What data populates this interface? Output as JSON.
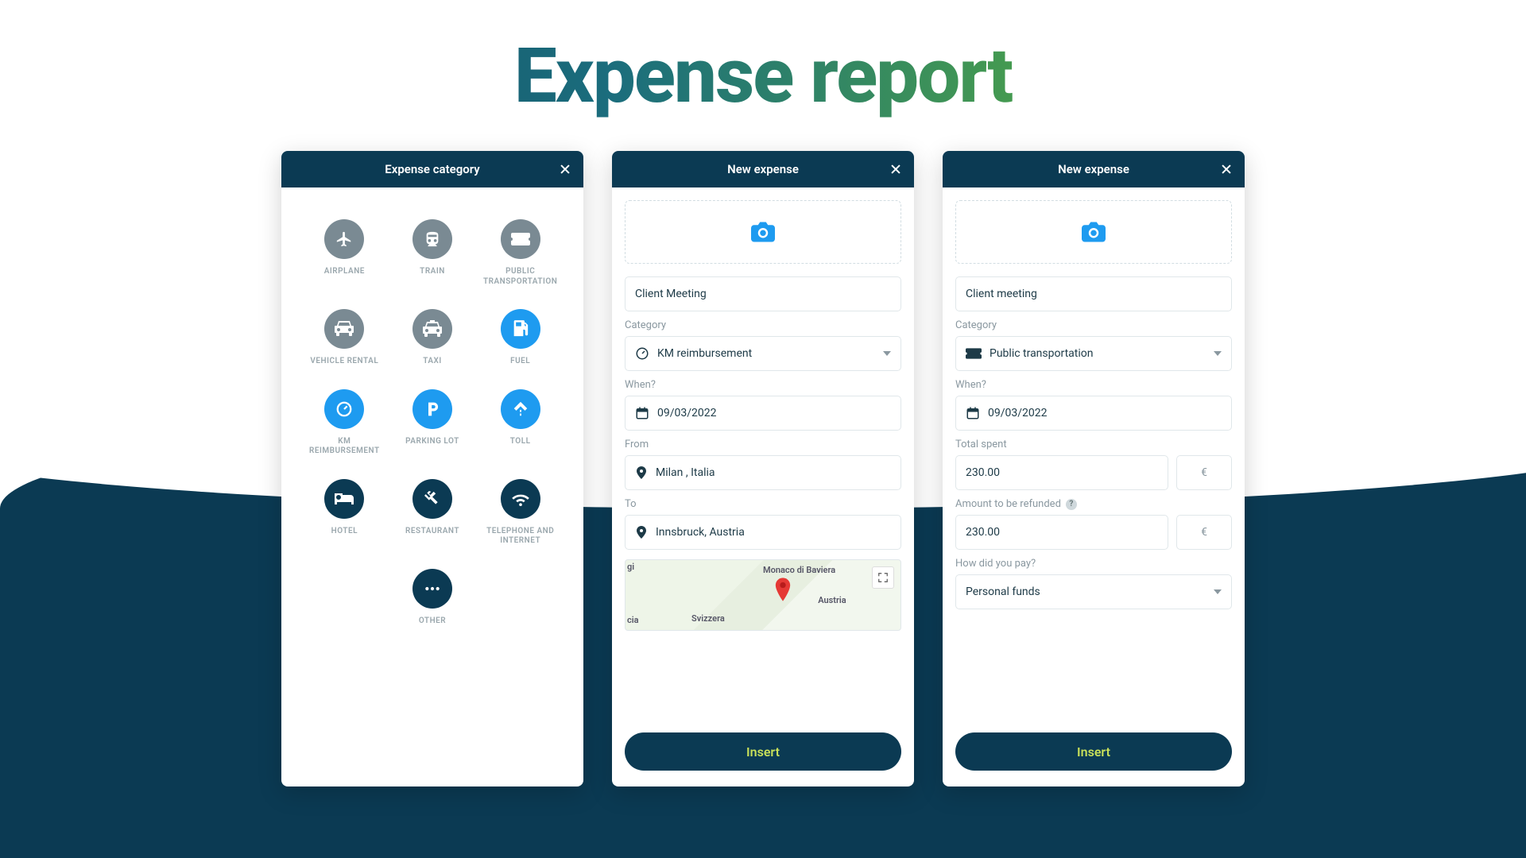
{
  "page_title": "Expense report",
  "panel1": {
    "title": "Expense category",
    "categories": [
      {
        "label": "AIRPLANE",
        "icon": "airplane",
        "cls": "c-grey"
      },
      {
        "label": "TRAIN",
        "icon": "train",
        "cls": "c-grey"
      },
      {
        "label": "PUBLIC TRANSPORTATION",
        "icon": "ticket",
        "cls": "c-grey"
      },
      {
        "label": "VEHICLE RENTAL",
        "icon": "car",
        "cls": "c-grey"
      },
      {
        "label": "TAXI",
        "icon": "taxi",
        "cls": "c-grey"
      },
      {
        "label": "FUEL",
        "icon": "fuel",
        "cls": "c-blue"
      },
      {
        "label": "KM REIMBURSEMENT",
        "icon": "gauge",
        "cls": "c-blue"
      },
      {
        "label": "PARKING LOT",
        "icon": "parking",
        "cls": "c-blue"
      },
      {
        "label": "TOLL",
        "icon": "road",
        "cls": "c-blue"
      },
      {
        "label": "HOTEL",
        "icon": "bed",
        "cls": "c-dark"
      },
      {
        "label": "RESTAURANT",
        "icon": "utensils",
        "cls": "c-dark"
      },
      {
        "label": "TELEPHONE AND INTERNET",
        "icon": "wifi",
        "cls": "c-dark"
      },
      {
        "label": "OTHER",
        "icon": "dots",
        "cls": "c-dark"
      }
    ]
  },
  "panel2": {
    "title": "New expense",
    "name_value": "Client Meeting",
    "category_label": "Category",
    "category_value": "KM reimbursement",
    "when_label": "When?",
    "when_value": "09/03/2022",
    "from_label": "From",
    "from_value": "Milan , Italia",
    "to_label": "To",
    "to_value": "Innsbruck, Austria",
    "map": {
      "labels": [
        "Monaco di Baviera",
        "Austria",
        "Svizzera"
      ],
      "side": "cia",
      "top": "gi"
    },
    "insert": "Insert"
  },
  "panel3": {
    "title": "New expense",
    "name_value": "Client meeting",
    "category_label": "Category",
    "category_value": "Public transportation",
    "when_label": "When?",
    "when_value": "09/03/2022",
    "total_label": "Total spent",
    "total_value": "230.00",
    "currency": "€",
    "refund_label": "Amount to be refunded",
    "refund_value": "230.00",
    "pay_label": "How did you pay?",
    "pay_value": "Personal funds",
    "insert": "Insert"
  }
}
